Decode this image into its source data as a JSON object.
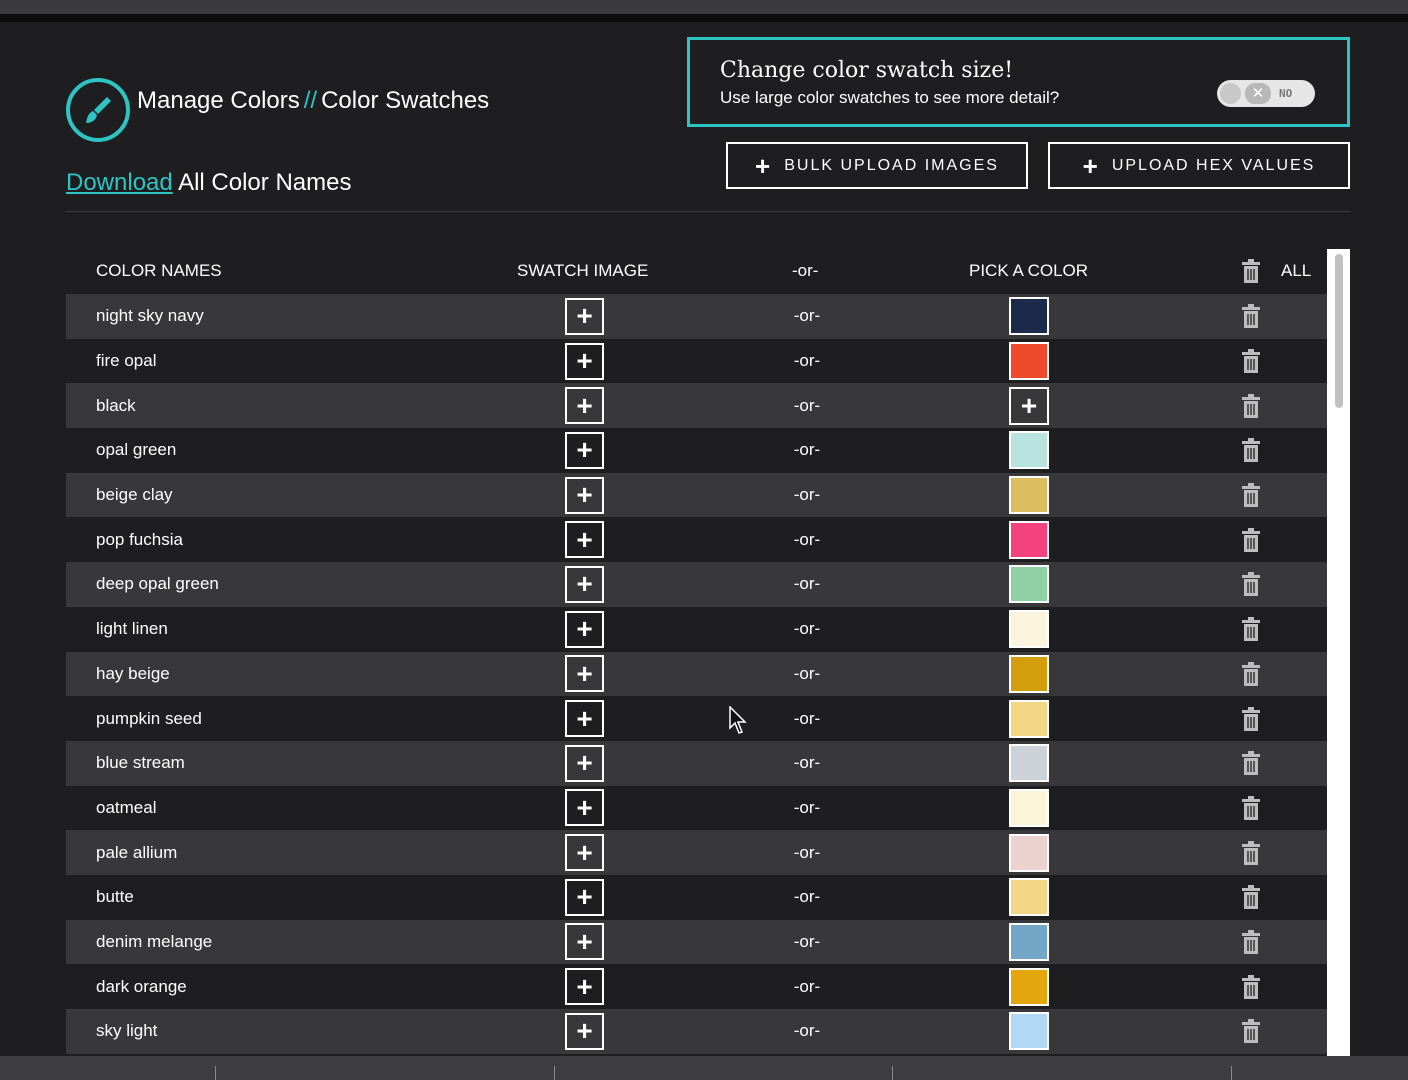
{
  "header": {
    "title_main": "Manage Colors",
    "title_sep": "//",
    "title_sub": "Color Swatches",
    "download_link": "Download",
    "download_rest": " All Color Names"
  },
  "size_panel": {
    "title": "Change color swatch size!",
    "subtitle": "Use large color swatches to see more detail?",
    "toggle_label": "NO",
    "toggle_on": false
  },
  "buttons": {
    "bulk_upload": "BULK UPLOAD IMAGES",
    "upload_hex": "UPLOAD HEX VALUES"
  },
  "table": {
    "headers": {
      "names": "COLOR NAMES",
      "swatch": "SWATCH IMAGE",
      "or": "-or-",
      "pick": "PICK A COLOR",
      "all": "ALL"
    },
    "or_text": "-or-",
    "rows": [
      {
        "name": "night sky navy",
        "color": "#1b2a4a"
      },
      {
        "name": "fire opal",
        "color": "#f04a2c"
      },
      {
        "name": "black",
        "color": null
      },
      {
        "name": "opal green",
        "color": "#b8e3df"
      },
      {
        "name": "beige clay",
        "color": "#dcbe60"
      },
      {
        "name": "pop fuchsia",
        "color": "#f4427e"
      },
      {
        "name": "deep opal green",
        "color": "#8fd0a5"
      },
      {
        "name": "light linen",
        "color": "#fbf4dc"
      },
      {
        "name": "hay beige",
        "color": "#d39f0c"
      },
      {
        "name": "pumpkin seed",
        "color": "#f2d785"
      },
      {
        "name": "blue stream",
        "color": "#cdd2d9"
      },
      {
        "name": "oatmeal",
        "color": "#fbf4d8"
      },
      {
        "name": "pale allium",
        "color": "#ebd2cf"
      },
      {
        "name": "butte",
        "color": "#f3d787"
      },
      {
        "name": "denim melange",
        "color": "#74a6c8"
      },
      {
        "name": "dark orange",
        "color": "#e4a60f"
      },
      {
        "name": "sky light",
        "color": "#b2d9f4"
      }
    ]
  },
  "accent_color": "#2ec4c4"
}
